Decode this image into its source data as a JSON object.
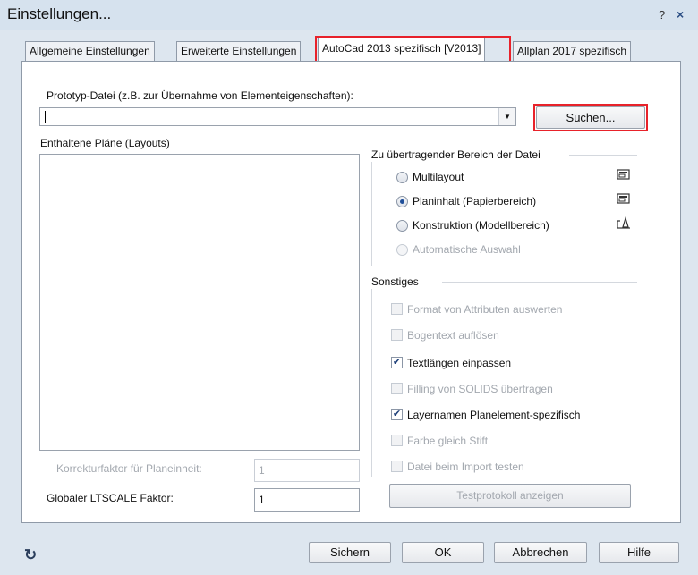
{
  "window": {
    "title": "Einstellungen...",
    "help": "?",
    "close": "×"
  },
  "tabs": [
    {
      "label": "Allgemeine Einstellungen"
    },
    {
      "label": "Erweiterte Einstellungen"
    },
    {
      "label": "AutoCad 2013 spezifisch [V2013]"
    },
    {
      "label": "Allplan 2017 spezifisch"
    }
  ],
  "prototype": {
    "label": "Prototyp-Datei (z.B. zur Übernahme von Elementeigenschaften):",
    "value": "",
    "search_button": "Suchen..."
  },
  "layouts": {
    "label": "Enthaltene Pläne (Layouts)",
    "items": []
  },
  "transfer_area": {
    "label": "Zu übertragender Bereich der Datei",
    "options": [
      {
        "label": "Multilayout",
        "selected": false,
        "enabled": true,
        "icon": "multilayout-icon"
      },
      {
        "label": "Planinhalt (Papierbereich)",
        "selected": true,
        "enabled": true,
        "icon": "paper-space-icon"
      },
      {
        "label": "Konstruktion (Modellbereich)",
        "selected": false,
        "enabled": true,
        "icon": "model-space-icon"
      },
      {
        "label": "Automatische Auswahl",
        "selected": false,
        "enabled": false
      }
    ]
  },
  "misc": {
    "label": "Sonstiges",
    "options": [
      {
        "label": "Format von Attributen auswerten",
        "checked": false,
        "enabled": false
      },
      {
        "label": "Bogentext auflösen",
        "checked": false,
        "enabled": false
      },
      {
        "label": "Textlängen einpassen",
        "checked": true,
        "enabled": true
      },
      {
        "label": "Filling von SOLIDS übertragen",
        "checked": false,
        "enabled": false
      },
      {
        "label": "Layernamen Planelement-spezifisch",
        "checked": true,
        "enabled": true
      },
      {
        "label": "Farbe gleich Stift",
        "checked": false,
        "enabled": false
      },
      {
        "label": "Datei beim Import testen",
        "checked": false,
        "enabled": false
      }
    ],
    "protocol_button": "Testprotokoll anzeigen"
  },
  "factors": {
    "correction_label": "Korrekturfaktor für Planeinheit:",
    "correction_value": "1",
    "ltscale_label": "Globaler LTSCALE Faktor:",
    "ltscale_value": "1"
  },
  "footer": {
    "reset_icon": "refresh-icon",
    "save": "Sichern",
    "ok": "OK",
    "cancel": "Abbrechen",
    "help": "Hilfe"
  }
}
